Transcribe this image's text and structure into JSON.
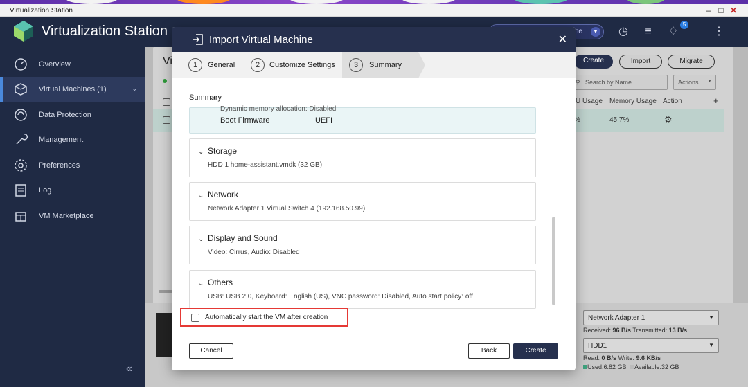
{
  "window": {
    "title": "Virtualization Station"
  },
  "app": {
    "title": "Virtualization Station",
    "search_placeholder": "ne",
    "notification_count": "5"
  },
  "sidebar": {
    "items": [
      {
        "label": "Overview",
        "icon": "overview-icon"
      },
      {
        "label": "Virtual Machines (1)",
        "icon": "vm-icon"
      },
      {
        "label": "Data Protection",
        "icon": "data-protection-icon"
      },
      {
        "label": "Management",
        "icon": "management-icon"
      },
      {
        "label": "Preferences",
        "icon": "preferences-icon"
      },
      {
        "label": "Log",
        "icon": "log-icon"
      },
      {
        "label": "VM Marketplace",
        "icon": "marketplace-icon"
      }
    ]
  },
  "background": {
    "heading_fragment": "Vi",
    "buttons": {
      "create": "Create",
      "import": "Import",
      "migrate": "Migrate"
    },
    "search_placeholder": "Search by Name",
    "actions_label": "Actions",
    "columns": {
      "cpu_usage": "U Usage",
      "memory_usage": "Memory Usage",
      "action": "Action",
      "add": "+"
    },
    "row": {
      "cpu": "%",
      "memory": "45.7%"
    },
    "network_select": "Network Adapter 1",
    "network_stats": {
      "received_label": "Received:",
      "received": "96 B/s",
      "transmitted_label": "Transmitted:",
      "transmitted": "13 B/s"
    },
    "disk_select": "HDD1",
    "disk_stats": {
      "read_label": "Read:",
      "read": "0 B/s",
      "write_label": "Write:",
      "write": "9.6 KB/s"
    },
    "storage_stats": {
      "used_label": "Used:",
      "used": "6.82 GB",
      "available_label": "Available:",
      "available": "32 GB"
    }
  },
  "modal": {
    "title": "Import Virtual Machine",
    "steps": [
      {
        "num": "1",
        "label": "General"
      },
      {
        "num": "2",
        "label": "Customize Settings"
      },
      {
        "num": "3",
        "label": "Summary"
      }
    ],
    "summary_title": "Summary",
    "first_card": {
      "clipped_row": "Dynamic memory allocation:   Disabled",
      "key": "Boot Firmware",
      "value": "UEFI"
    },
    "sections": [
      {
        "title": "Storage",
        "detail": "HDD 1 home-assistant.vmdk (32 GB)"
      },
      {
        "title": "Network",
        "detail": "Network Adapter 1 Virtual Switch 4 (192.168.50.99)"
      },
      {
        "title": "Display and Sound",
        "detail": "Video: Cirrus, Audio: Disabled"
      },
      {
        "title": "Others",
        "detail": "USB: USB 2.0, Keyboard: English (US), VNC password: Disabled, Auto start policy: off"
      }
    ],
    "autostart_label": "Automatically start the VM after creation",
    "buttons": {
      "cancel": "Cancel",
      "back": "Back",
      "create": "Create"
    }
  }
}
